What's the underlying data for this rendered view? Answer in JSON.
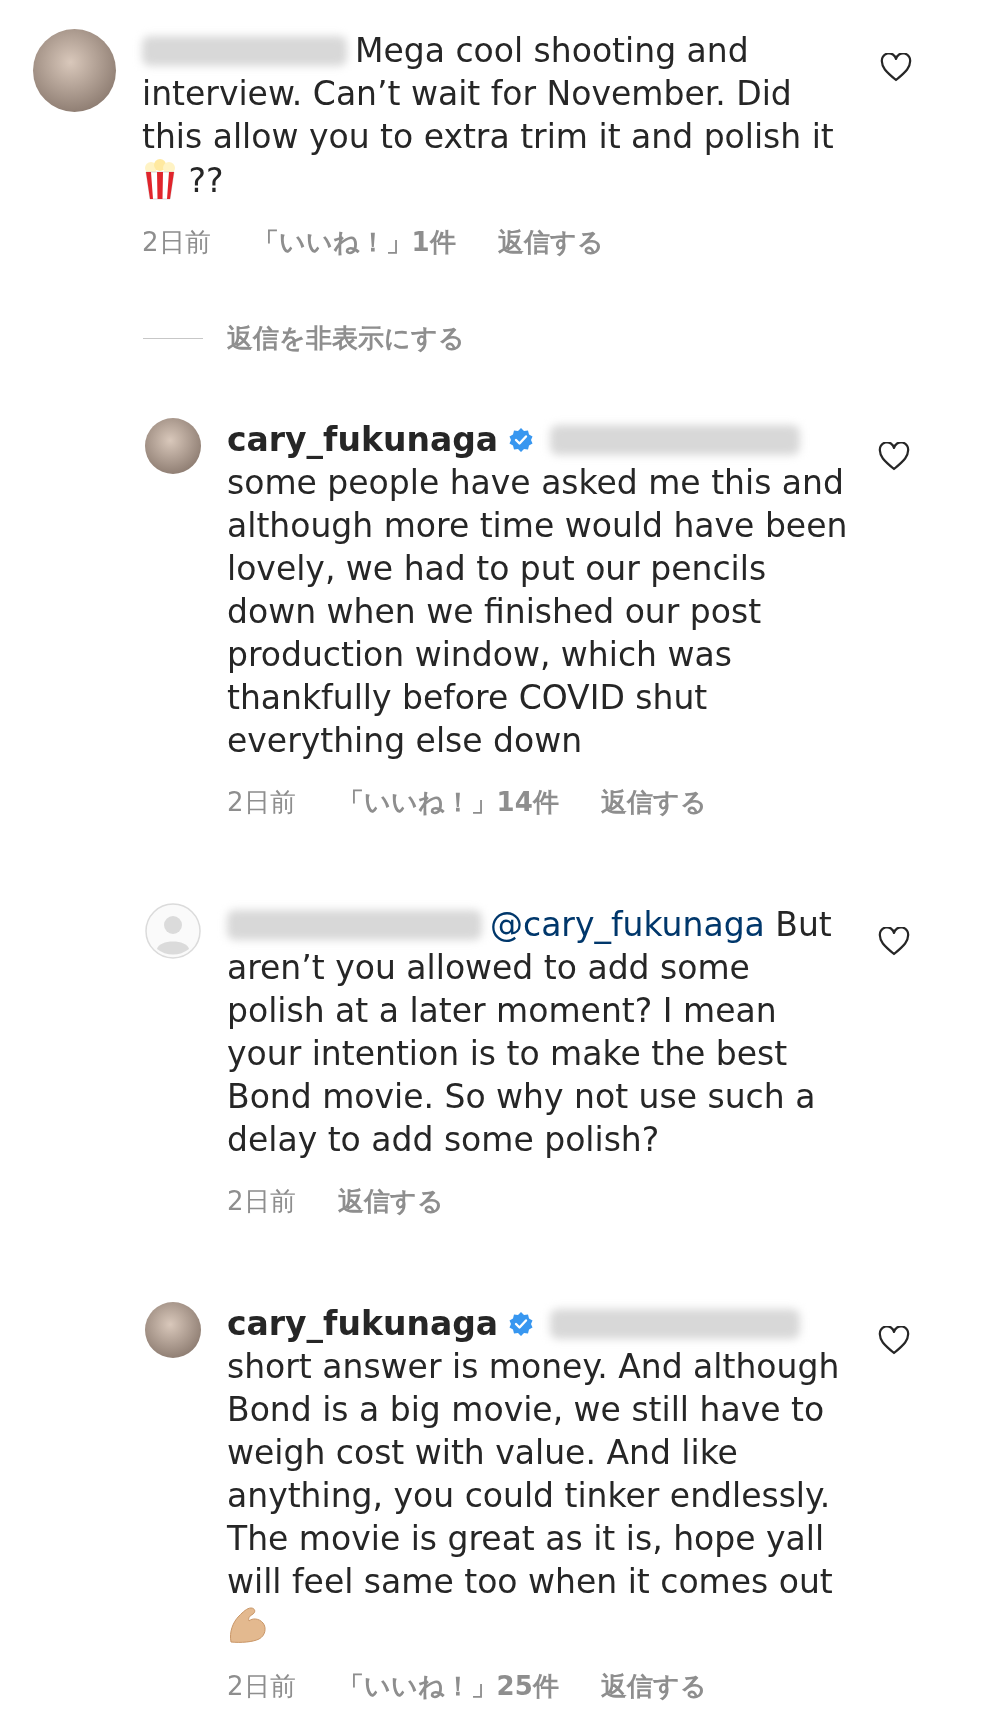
{
  "comments": [
    {
      "default_avatar": false,
      "author_blurred": true,
      "parts": [
        {
          "kind": "text",
          "text": "Mega cool shooting and interview. Can’t wait for November. Did this allow you to extra trim it and polish it "
        },
        {
          "kind": "popcorn"
        },
        {
          "kind": "text",
          "text": " ??"
        }
      ],
      "time": "2日前",
      "likes": "「いいね！」1件",
      "reply": "返信する",
      "liked": false
    }
  ],
  "hide_replies": "返信を非表示にする",
  "replies": [
    {
      "default_avatar": false,
      "author": "cary_fukunaga",
      "verified": true,
      "mention_blurred": true,
      "parts": [
        {
          "kind": "text",
          "text": "some people have asked me this and although more time would have been lovely, we had to put our pencils down when we finished our post production window, which was thankfully before COVID shut everything else down"
        }
      ],
      "time": "2日前",
      "likes": "「いいね！」14件",
      "reply": "返信する",
      "liked": false
    },
    {
      "default_avatar": true,
      "author_blurred": true,
      "parts": [
        {
          "kind": "mention",
          "text": "@cary_fukunaga"
        },
        {
          "kind": "text",
          "text": " But aren’t you allowed to add some polish at a later moment? I mean your intention is to make the best Bond movie. So why not use such a delay to add some polish?"
        }
      ],
      "time": "2日前",
      "reply": "返信する",
      "liked": false
    },
    {
      "default_avatar": false,
      "author": "cary_fukunaga",
      "verified": true,
      "mention_blurred": true,
      "parts": [
        {
          "kind": "text",
          "text": "short answer is money. And although Bond is a big movie, we still have to weigh cost with value. And like anything, you could tinker endlessly. The movie is great as it is, hope yall will feel same too when it comes out "
        },
        {
          "kind": "flexed-arm"
        }
      ],
      "time": "2日前",
      "likes": "「いいね！」25件",
      "reply": "返信する",
      "liked": false
    }
  ]
}
